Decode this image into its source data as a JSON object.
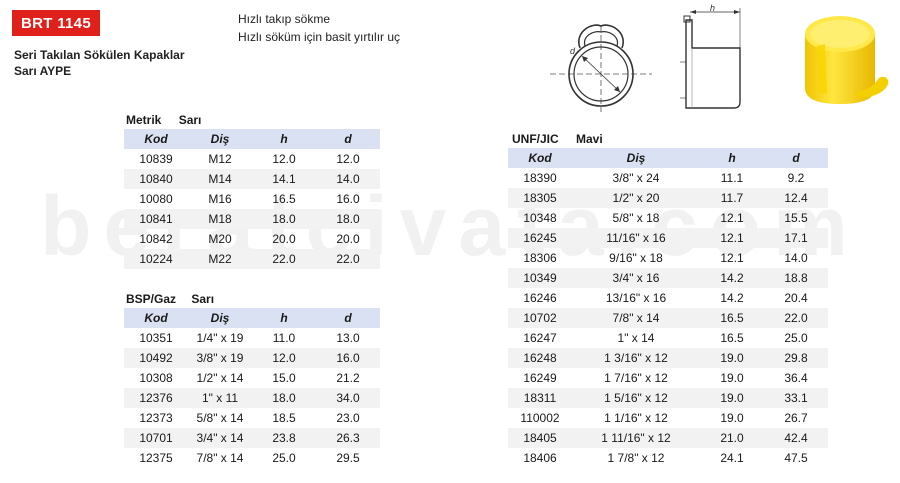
{
  "header": {
    "code": "BRT 1145",
    "subtitle_line1": "Seri Takılan Sökülen Kapaklar",
    "subtitle_line2": "Sarı AYPE",
    "feature1": "Hızlı takıp sökme",
    "feature2": "Hızlı söküm için basit yırtılır uç"
  },
  "drawing": {
    "h_label": "h",
    "d_label": "d"
  },
  "watermark": "beratcivata.com",
  "metric": {
    "title": "Metrik",
    "color": "Sarı",
    "headers": [
      "Kod",
      "Diş",
      "h",
      "d"
    ],
    "rows": [
      [
        "10839",
        "M12",
        "12.0",
        "12.0"
      ],
      [
        "10840",
        "M14",
        "14.1",
        "14.0"
      ],
      [
        "10080",
        "M16",
        "16.5",
        "16.0"
      ],
      [
        "10841",
        "M18",
        "18.0",
        "18.0"
      ],
      [
        "10842",
        "M20",
        "20.0",
        "20.0"
      ],
      [
        "10224",
        "M22",
        "22.0",
        "22.0"
      ]
    ]
  },
  "bsp": {
    "title": "BSP/Gaz",
    "color": "Sarı",
    "headers": [
      "Kod",
      "Diş",
      "h",
      "d"
    ],
    "rows": [
      [
        "10351",
        "1/4\" x 19",
        "11.0",
        "13.0"
      ],
      [
        "10492",
        "3/8\" x 19",
        "12.0",
        "16.0"
      ],
      [
        "10308",
        "1/2\" x 14",
        "15.0",
        "21.2"
      ],
      [
        "12376",
        "1\" x 11",
        "18.0",
        "34.0"
      ],
      [
        "12373",
        "5/8\" x 14",
        "18.5",
        "23.0"
      ],
      [
        "10701",
        "3/4\" x 14",
        "23.8",
        "26.3"
      ],
      [
        "12375",
        "7/8\" x 14",
        "25.0",
        "29.5"
      ]
    ]
  },
  "unf": {
    "title": "UNF/JIC",
    "color": "Mavi",
    "headers": [
      "Kod",
      "Diş",
      "h",
      "d"
    ],
    "rows": [
      [
        "18390",
        "3/8\" x 24",
        "11.1",
        "9.2"
      ],
      [
        "18305",
        "1/2\" x 20",
        "11.7",
        "12.4"
      ],
      [
        "10348",
        "5/8\" x 18",
        "12.1",
        "15.5"
      ],
      [
        "16245",
        "11/16\" x 16",
        "12.1",
        "17.1"
      ],
      [
        "18306",
        "9/16\" x 18",
        "12.1",
        "14.0"
      ],
      [
        "10349",
        "3/4\" x 16",
        "14.2",
        "18.8"
      ],
      [
        "16246",
        "13/16\" x 16",
        "14.2",
        "20.4"
      ],
      [
        "10702",
        "7/8\" x 14",
        "16.5",
        "22.0"
      ],
      [
        "16247",
        "1\" x 14",
        "16.5",
        "25.0"
      ],
      [
        "16248",
        "1 3/16\" x 12",
        "19.0",
        "29.8"
      ],
      [
        "16249",
        "1 7/16\" x 12",
        "19.0",
        "36.4"
      ],
      [
        "18311",
        "1 5/16\" x 12",
        "19.0",
        "33.1"
      ],
      [
        "110002",
        "1 1/16\" x 12",
        "19.0",
        "26.7"
      ],
      [
        "18405",
        "1 11/16\" x 12",
        "21.0",
        "42.4"
      ],
      [
        "18406",
        "1 7/8\" x 12",
        "24.1",
        "47.5"
      ]
    ]
  },
  "colors": {
    "brand_red": "#e0201b",
    "header_blue": "#d9e1f2",
    "cap_yellow": "#f5d800"
  }
}
